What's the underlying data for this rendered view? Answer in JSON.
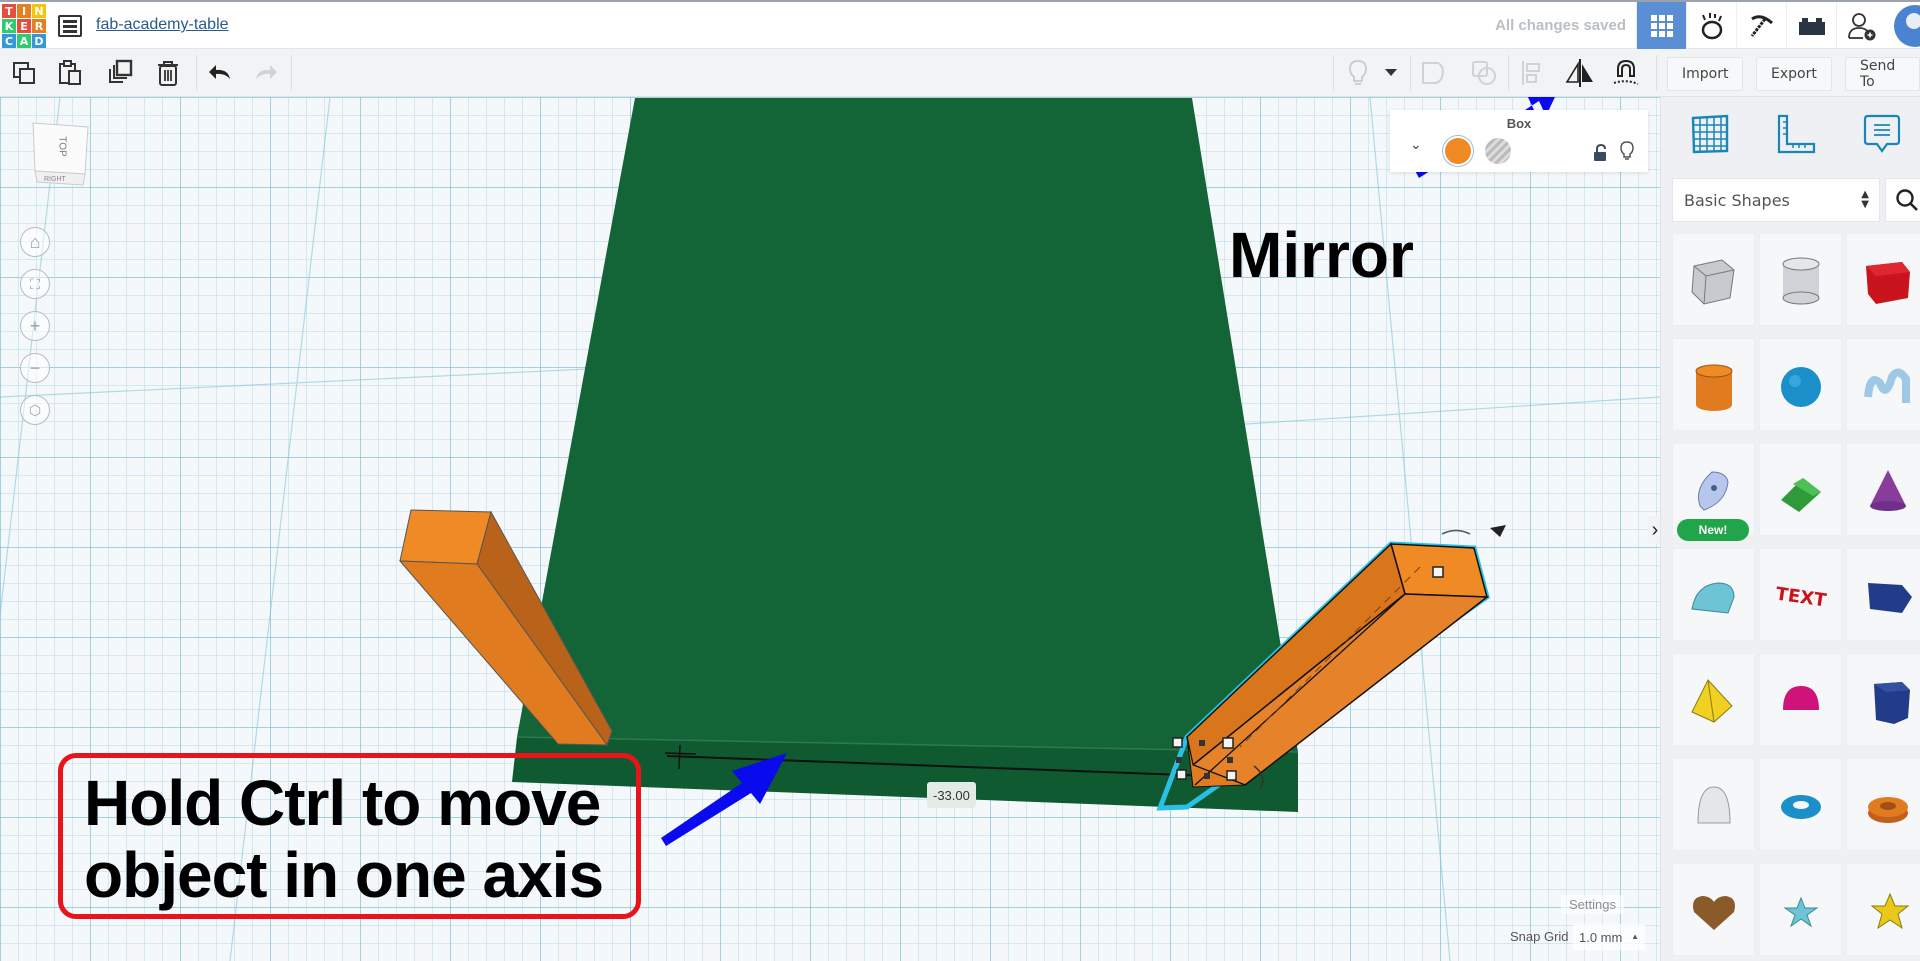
{
  "header": {
    "logo_letters": [
      "T",
      "I",
      "N",
      "K",
      "E",
      "R",
      "C",
      "A",
      "D"
    ],
    "logo_colors": [
      "#e74c3c",
      "#e67e22",
      "#f1c40f",
      "#2ecc71",
      "#e74c3c",
      "#e67e22",
      "#3498db",
      "#2ecc71",
      "#3498db"
    ],
    "design_title": "fab-academy-table",
    "save_status": "All changes saved",
    "buttons": [
      {
        "name": "3d-design-view",
        "icon": "grid-icon",
        "active": true
      },
      {
        "name": "codeblocks",
        "icon": "codeblocks-icon",
        "active": false
      },
      {
        "name": "minecraft-export",
        "icon": "pickaxe-icon",
        "active": false
      },
      {
        "name": "lego-bricks",
        "icon": "brick-icon",
        "active": false
      },
      {
        "name": "invite-collaborators",
        "icon": "add-user-icon",
        "active": false
      }
    ]
  },
  "toolbar": {
    "left": [
      {
        "name": "copy",
        "icon": "copy-icon",
        "enabled": true
      },
      {
        "name": "paste",
        "icon": "paste-icon",
        "enabled": true
      },
      {
        "name": "duplicate",
        "icon": "duplicate-icon",
        "enabled": true
      },
      {
        "name": "delete",
        "icon": "trash-icon",
        "enabled": true
      },
      {
        "name": "undo",
        "icon": "undo-icon",
        "enabled": true
      },
      {
        "name": "redo",
        "icon": "redo-icon",
        "enabled": false
      }
    ],
    "right": [
      {
        "name": "notes",
        "icon": "lightbulb-icon",
        "enabled": false
      },
      {
        "name": "notes-dropdown",
        "icon": "caret-down-icon",
        "enabled": true
      },
      {
        "name": "group",
        "icon": "group-icon",
        "enabled": false
      },
      {
        "name": "ungroup",
        "icon": "ungroup-icon",
        "enabled": false
      },
      {
        "name": "align",
        "icon": "align-icon",
        "enabled": false
      },
      {
        "name": "mirror",
        "icon": "mirror-icon",
        "enabled": true
      },
      {
        "name": "cruise",
        "icon": "magnet-icon",
        "enabled": true
      }
    ],
    "import_label": "Import",
    "export_label": "Export",
    "send_to_label": "Send To"
  },
  "viewport": {
    "viewcube": {
      "top_label": "TOP",
      "side_label": "RIGHT"
    },
    "nav": [
      {
        "name": "home-view",
        "icon": "home-icon"
      },
      {
        "name": "fit-all",
        "icon": "fit-view-icon"
      },
      {
        "name": "zoom-in",
        "icon": "plus-icon"
      },
      {
        "name": "zoom-out",
        "icon": "minus-icon"
      },
      {
        "name": "perspective-toggle",
        "icon": "perspective-icon"
      }
    ],
    "inspector": {
      "title": "Box",
      "solid_color": "#f08a24",
      "solid_label": "Solid",
      "hole_label": "Hole"
    },
    "measurement_value": "-33.00",
    "settings_label": "Settings",
    "snap_grid_label": "Snap Grid",
    "snap_grid_value": "1.0 mm",
    "colors": {
      "plate": "#136537",
      "box_orange": "#f08a24",
      "selection_outline": "#29c0e6"
    }
  },
  "annotations": {
    "mirror_label": "Mirror",
    "ctrl_tip_lines": [
      "Hold Ctrl to move",
      "object in one axis"
    ],
    "arrow_color": "#0a0aee",
    "box_color": "#e8141b"
  },
  "panel": {
    "tools": [
      {
        "name": "workplane",
        "icon": "workplane-icon"
      },
      {
        "name": "ruler",
        "icon": "ruler-icon"
      },
      {
        "name": "notes",
        "icon": "note-icon"
      }
    ],
    "library_selected": "Basic Shapes",
    "new_badge": "New!",
    "shapes": [
      {
        "name": "box-hole",
        "label": "Box Hole"
      },
      {
        "name": "cylinder-hole",
        "label": "Cylinder Hole"
      },
      {
        "name": "box",
        "label": "Box"
      },
      {
        "name": "cylinder",
        "label": "Cylinder"
      },
      {
        "name": "sphere",
        "label": "Sphere"
      },
      {
        "name": "scribble",
        "label": "Scribble"
      },
      {
        "name": "shape-generator",
        "label": "Sketch"
      },
      {
        "name": "roof",
        "label": "Roof"
      },
      {
        "name": "cone",
        "label": "Cone"
      },
      {
        "name": "round-roof",
        "label": "Round Roof"
      },
      {
        "name": "text",
        "label": "Text"
      },
      {
        "name": "polygon",
        "label": "Polygon"
      },
      {
        "name": "pyramid",
        "label": "Pyramid"
      },
      {
        "name": "half-sphere",
        "label": "Half Sphere"
      },
      {
        "name": "polygon-prism",
        "label": "Polygon Prism"
      },
      {
        "name": "paraboloid",
        "label": "Paraboloid"
      },
      {
        "name": "torus",
        "label": "Torus"
      },
      {
        "name": "tube",
        "label": "Tube"
      },
      {
        "name": "heart",
        "label": "Heart"
      },
      {
        "name": "star",
        "label": "Star"
      },
      {
        "name": "star-extruded",
        "label": "Star"
      }
    ]
  }
}
